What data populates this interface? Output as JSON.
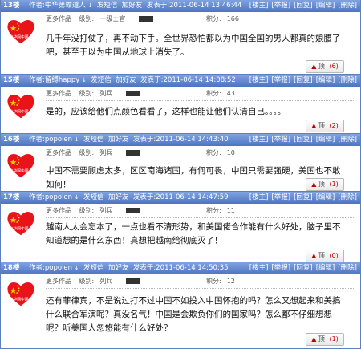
{
  "labels": {
    "author_prefix": "作者:",
    "profile": "更多作品",
    "pm": "发短信",
    "add_friend": "加好友",
    "posted_prefix": "发表于:",
    "level_prefix": "级别:",
    "points_prefix": "积分:",
    "actions": [
      "[楼主]",
      "[举报]",
      "[回复]",
      "[编辑]",
      "[删除]"
    ],
    "vote_label": "顶",
    "avatar_caption": "中华网中国心"
  },
  "posts": [
    {
      "floor": "13楼",
      "author": "中华第霸道人",
      "posted": "2011-06-14 13:46:44",
      "level": "一级士官",
      "points": "166",
      "content": "几千年没打仗了，再不动下手。全世界恐怕都以为中国全国的男人都真的娘腰了吧，甚至于以为中国从地球上消失了。",
      "votes": "(6)"
    },
    {
      "floor": "15楼",
      "author": "留缚happy",
      "posted": "2011-06-14 14:08:52",
      "level": "列兵",
      "points": "43",
      "content": "是的，应该给他们点颜色看看了，这样也能让他们认清自己。。。。",
      "votes": "(2)"
    },
    {
      "floor": "16楼",
      "author": "popolen",
      "posted": "2011-06-14 14:43:40",
      "level": "列兵",
      "points": "10",
      "content": "中国不需要顾虑太多，区区南海诸国，有何可畏，中国只需要强硬，美国也不敢如何！",
      "votes": "(1)"
    },
    {
      "floor": "17楼",
      "author": "popolen",
      "posted": "2011-06-14 14:47:59",
      "level": "列兵",
      "points": "11",
      "content": "越南人太会忘本了，一点也看不清形势，和美国佬合作能有什么好处，脑子里不知道想的是什么东西！真想把越南给彻底灭了！",
      "votes": "(0)"
    },
    {
      "floor": "18楼",
      "author": "popolen",
      "posted": "2011-06-14 14:50:35",
      "level": "列兵",
      "points": "12",
      "content": "还有菲律宾，不是说过打不过中国不如投入中国怀抱的吗？怎么又想起来和美搞什么联合军演呢？真没名气！中国是会欺负你们的国家吗？怎么都不仔细想想呢？听美国人忽悠能有什么好处？",
      "votes": "(1)"
    }
  ],
  "colors": {
    "header_top": "#7fa3e0",
    "header_bottom": "#4d74c2",
    "vote_count": "#c00000",
    "heart": "#e8141a"
  }
}
